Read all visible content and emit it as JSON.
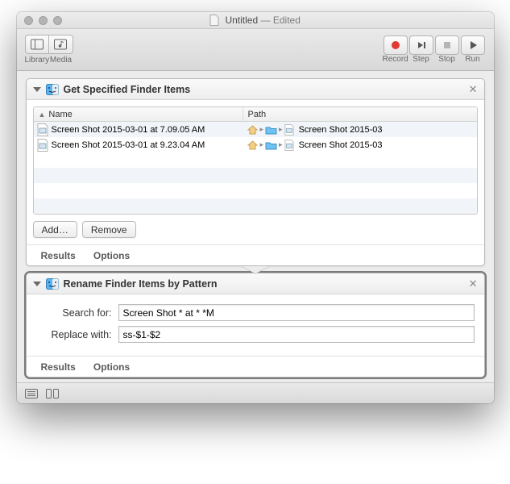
{
  "window": {
    "title": "Untitled",
    "status": "Edited"
  },
  "toolbar": {
    "library": "Library",
    "media": "Media",
    "record": "Record",
    "step": "Step",
    "stop": "Stop",
    "run": "Run"
  },
  "action1": {
    "title": "Get Specified Finder Items",
    "columns": {
      "name": "Name",
      "path": "Path"
    },
    "rows": [
      {
        "name": "Screen Shot 2015-03-01 at 7.09.05 AM",
        "pathname": "Screen Shot 2015-03"
      },
      {
        "name": "Screen Shot 2015-03-01 at 9.23.04 AM",
        "pathname": "Screen Shot 2015-03"
      }
    ],
    "add": "Add…",
    "remove": "Remove",
    "results": "Results",
    "options": "Options"
  },
  "action2": {
    "title": "Rename Finder Items by Pattern",
    "search_label": "Search for:",
    "replace_label": "Replace with:",
    "search_value": "Screen Shot * at * *M",
    "replace_value": "ss-$1-$2",
    "results": "Results",
    "options": "Options"
  }
}
